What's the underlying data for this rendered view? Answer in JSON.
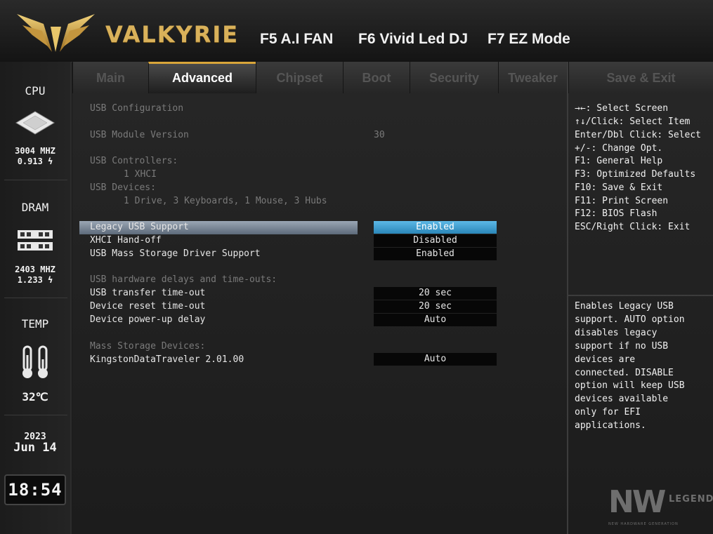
{
  "header": {
    "brand": "VALKYRIE",
    "hotkeys": [
      "F5 A.I FAN",
      "F6 Vivid Led DJ",
      "F7 EZ Mode"
    ]
  },
  "sidebar": {
    "cpu_label": "CPU",
    "cpu_freq": "3004 MHZ",
    "cpu_volt": "0.913 ϟ",
    "dram_label": "DRAM",
    "dram_freq": "2403 MHZ",
    "dram_volt": "1.233 ϟ",
    "temp_label": "TEMP",
    "temp_value": "32℃",
    "year": "2023",
    "date": "Jun 14",
    "time": "18:54"
  },
  "tabs": [
    "Main",
    "Advanced",
    "Chipset",
    "Boot",
    "Security",
    "Tweaker",
    "Save & Exit"
  ],
  "active_tab": "Advanced",
  "content": {
    "section_title": "USB Configuration",
    "module_version_label": "USB Module Version",
    "module_version_value": "30",
    "controllers_label": "USB Controllers:",
    "controllers_value": "1 XHCI",
    "devices_label": "USB Devices:",
    "devices_value": "1 Drive, 3 Keyboards, 1 Mouse, 3 Hubs",
    "options": [
      {
        "label": "Legacy USB Support",
        "value": "Enabled"
      },
      {
        "label": "XHCI Hand-off",
        "value": "Disabled"
      },
      {
        "label": "USB Mass Storage Driver Support",
        "value": "Enabled"
      }
    ],
    "delays_header": "USB hardware delays and time-outs:",
    "delays": [
      {
        "label": "USB transfer time-out",
        "value": "20 sec"
      },
      {
        "label": "Device reset time-out",
        "value": "20 sec"
      },
      {
        "label": "Device power-up delay",
        "value": "Auto"
      }
    ],
    "mass_storage_header": "Mass Storage Devices:",
    "mass_storage": [
      {
        "label": "KingstonDataTraveler 2.01.00",
        "value": "Auto"
      }
    ]
  },
  "help_keys": [
    "→←: Select Screen",
    "↑↓/Click: Select Item",
    "Enter/Dbl Click: Select",
    "+/-: Change Opt.",
    "F1: General Help",
    "F3: Optimized Defaults",
    "F10: Save & Exit",
    "F11: Print Screen",
    "F12: BIOS Flash",
    "ESC/Right Click: Exit"
  ],
  "help_text": [
    "Enables Legacy USB",
    "support. AUTO option",
    "disables legacy",
    "support if no USB",
    "devices are",
    "connected. DISABLE",
    "option will keep USB",
    "devices available",
    "only for EFI",
    "applications."
  ],
  "watermark": {
    "main": "NW",
    "sub": "LEGEND",
    "tagline": "NEW HARDWARE GENERATION"
  },
  "colors": {
    "accent_gold": "#d9b15a",
    "selected_blue": "#3fa3d6"
  }
}
